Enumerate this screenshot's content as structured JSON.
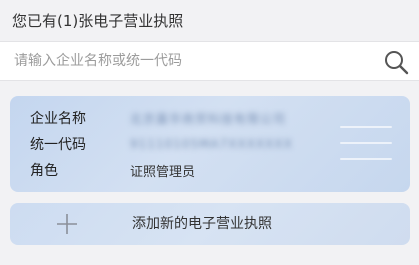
{
  "header": {
    "text": "您已有(1)张电子营业执照"
  },
  "search": {
    "placeholder": "请输入企业名称或统一代码",
    "value": "",
    "icon": "search-icon"
  },
  "license_card": {
    "fields": [
      {
        "label": "企业名称",
        "value": "北京嘉华商贸科技有限公司"
      },
      {
        "label": "统一代码",
        "value": "91110105MA7XXXXXXX"
      },
      {
        "label": "角色",
        "value": "证照管理员"
      }
    ]
  },
  "add_card": {
    "label": "添加新的电子营业执照",
    "icon": "plus-icon"
  },
  "colors": {
    "page_background": "#f2f2f4",
    "card_gradient_start": "#c4d6ef",
    "card_gradient_end": "#c6d7ee",
    "text_primary": "#333333",
    "placeholder": "#9c9c9c"
  }
}
